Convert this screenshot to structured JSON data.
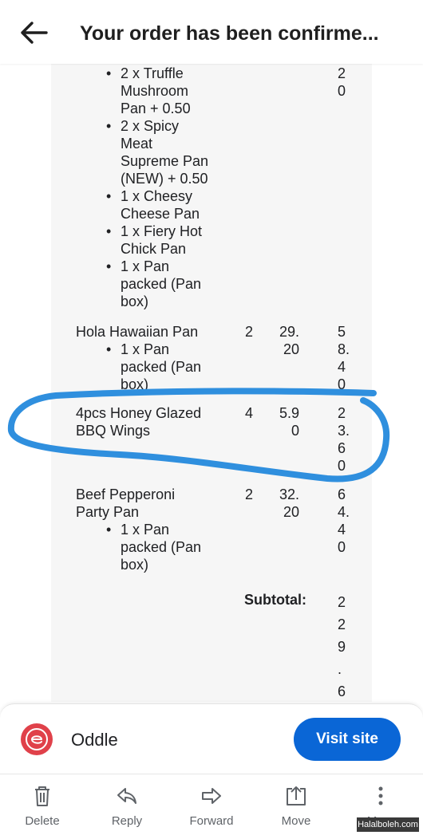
{
  "header": {
    "title": "Your order has been confirme..."
  },
  "items": [
    {
      "bullets": [
        "2 x Truffle\nMushroom\nPan + 0.50",
        "2 x Spicy\nMeat\nSupreme Pan\n(NEW) + 0.50",
        "1 x Cheesy\nCheese Pan",
        "1 x Fiery Hot\nChick Pan",
        "1 x Pan\npacked (Pan\nbox)"
      ],
      "total_partial": "2\n0"
    },
    {
      "name": "Hola Hawaiian Pan",
      "qty": "2",
      "price": "29.\n20",
      "total": "5\n8.\n4\n0",
      "bullets": [
        "1 x Pan\npacked (Pan\nbox)"
      ]
    },
    {
      "name": "4pcs Honey Glazed\nBBQ Wings",
      "qty": "4",
      "price": "5.9\n0",
      "total": "2\n3.\n6\n0"
    },
    {
      "name": "Beef Pepperoni\nParty Pan",
      "qty": "2",
      "price": "32.\n20",
      "total": "6\n4.\n4\n0",
      "bullets": [
        "1 x Pan\npacked (Pan\nbox)"
      ]
    }
  ],
  "subtotal": {
    "label": "Subtotal:",
    "value": "2\n2\n9\n.\n6"
  },
  "highlight_color": "#2f8fde",
  "sender": {
    "name": "Oddle",
    "logo_color": "#e0414a",
    "visit_label": "Visit site",
    "button_color": "#0a66d6"
  },
  "toolbar": [
    {
      "label": "Delete",
      "icon": "trash-icon"
    },
    {
      "label": "Reply",
      "icon": "reply-icon"
    },
    {
      "label": "Forward",
      "icon": "forward-icon"
    },
    {
      "label": "Move",
      "icon": "move-icon"
    },
    {
      "label": "More",
      "icon": "more-icon"
    }
  ],
  "watermark": "Halalboleh.com"
}
